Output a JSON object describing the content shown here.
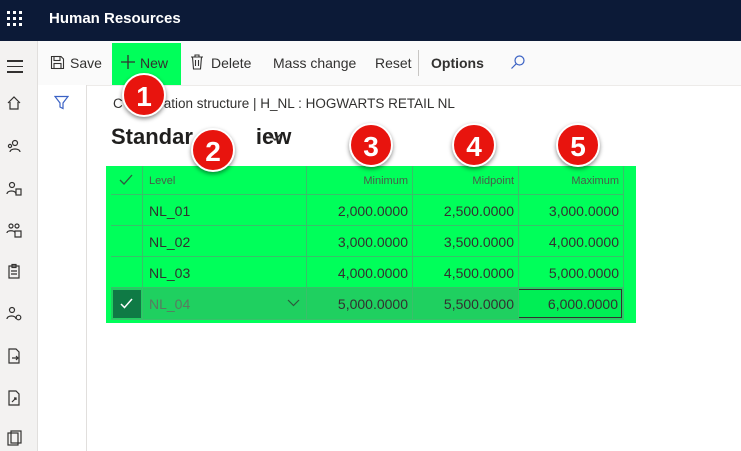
{
  "app": {
    "title": "Human Resources"
  },
  "actionbar": {
    "save": "Save",
    "new": "New",
    "delete": "Delete",
    "mass_change": "Mass change",
    "reset": "Reset",
    "options": "Options"
  },
  "breadcrumb": {
    "text": "Compensation structure  |  H_NL : HOGWARTS RETAIL NL",
    "visible_prefix": "C",
    "visible_rest": "ation structure  |  H_NL : HOGWARTS RETAIL NL"
  },
  "view": {
    "title": "Standard view",
    "title_visible_a": "Standar",
    "title_visible_b": "iew"
  },
  "grid": {
    "headers": {
      "level": "Level",
      "minimum": "Minimum",
      "midpoint": "Midpoint",
      "maximum": "Maximum"
    },
    "rows": [
      {
        "level": "NL_01",
        "minimum": "2,000.0000",
        "midpoint": "2,500.0000",
        "maximum": "3,000.0000"
      },
      {
        "level": "NL_02",
        "minimum": "3,000.0000",
        "midpoint": "3,500.0000",
        "maximum": "4,000.0000"
      },
      {
        "level": "NL_03",
        "minimum": "4,000.0000",
        "midpoint": "4,500.0000",
        "maximum": "5,000.0000"
      },
      {
        "level": "NL_04",
        "minimum": "5,000.0000",
        "midpoint": "5,500.0000",
        "maximum": "6,000.0000"
      }
    ],
    "selected_row": 3
  },
  "badges": [
    "1",
    "2",
    "3",
    "4",
    "5"
  ],
  "colors": {
    "topbar": "#0c1a37",
    "highlight": "#00ff5a",
    "badge": "#e8140e"
  },
  "icons": {
    "rail": [
      "menu-icon",
      "home-icon",
      "people-icon",
      "person-document-icon",
      "people-team-icon",
      "clipboard-icon",
      "person-settings-icon",
      "document-arrow-icon",
      "document-share-icon",
      "documents-icon"
    ]
  }
}
